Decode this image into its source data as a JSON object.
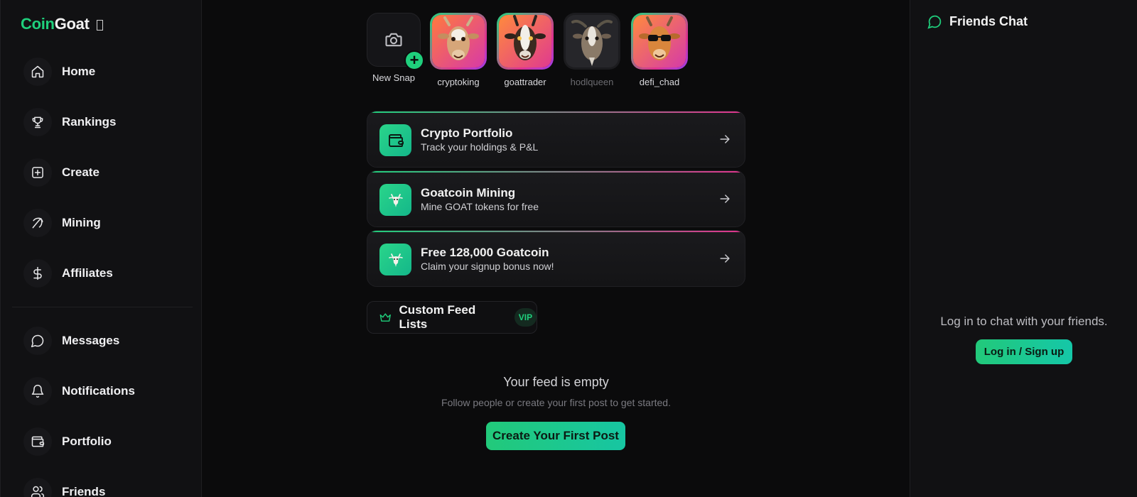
{
  "brand": {
    "coin": "Coin",
    "goat": "Goat"
  },
  "sidebar": {
    "items": [
      {
        "label": "Home",
        "icon": "home-icon"
      },
      {
        "label": "Rankings",
        "icon": "trophy-icon"
      },
      {
        "label": "Create",
        "icon": "plus-square-icon"
      },
      {
        "label": "Mining",
        "icon": "pickaxe-icon"
      },
      {
        "label": "Affiliates",
        "icon": "dollar-icon"
      },
      {
        "label": "Messages",
        "icon": "chat-bubble-icon"
      },
      {
        "label": "Notifications",
        "icon": "bell-icon"
      },
      {
        "label": "Portfolio",
        "icon": "wallet-icon"
      },
      {
        "label": "Friends",
        "icon": "users-icon"
      }
    ]
  },
  "stories": {
    "new_snap": "New Snap",
    "items": [
      {
        "name": "cryptoking",
        "style": "ring"
      },
      {
        "name": "goattrader",
        "style": "ring"
      },
      {
        "name": "hodlqueen",
        "style": "dim"
      },
      {
        "name": "defi_chad",
        "style": "ring"
      }
    ]
  },
  "cards": [
    {
      "title": "Crypto Portfolio",
      "subtitle": "Track your holdings & P&L",
      "icon": "wallet-icon"
    },
    {
      "title": "Goatcoin Mining",
      "subtitle": "Mine GOAT tokens for free",
      "icon": "goat-icon"
    },
    {
      "title": "Free 128,000 Goatcoin",
      "subtitle": "Claim your signup bonus now!",
      "icon": "goat-icon"
    }
  ],
  "custom_feeds": {
    "label": "Custom Feed Lists",
    "badge": "VIP",
    "icon": "crown-icon"
  },
  "feed": {
    "empty_title": "Your feed is empty",
    "empty_subtitle": "Follow people or create your first post to get started.",
    "cta": "Create Your First Post"
  },
  "chat": {
    "title": "Friends Chat",
    "message": "Log in to chat with your friends.",
    "login_label": "Log in / Sign up"
  },
  "colors": {
    "accent": "#1fcf7c",
    "pink": "#e0338d",
    "background": "#0b0b0c",
    "panel": "#111113"
  }
}
